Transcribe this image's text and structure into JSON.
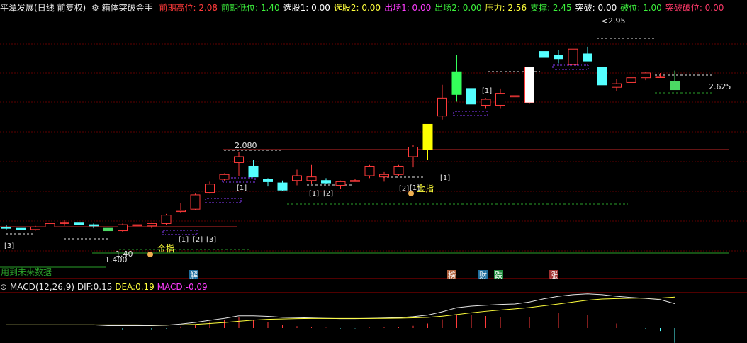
{
  "header": {
    "stock_name": "平潭发展",
    "period": "(日线 前复权)",
    "indicator": "箱体突破金手",
    "items": [
      {
        "label": "前期高位:",
        "value": "2.08",
        "color": "#ff3a3a"
      },
      {
        "label": "前期低位:",
        "value": "1.40",
        "color": "#3cf03c"
      },
      {
        "label": "选股1:",
        "value": "0.00",
        "color": "#ffffff"
      },
      {
        "label": "选股2:",
        "value": "0.00",
        "color": "#ffff3c"
      },
      {
        "label": "出场1:",
        "value": "0.00",
        "color": "#ff3cff"
      },
      {
        "label": "出场2:",
        "value": "0.00",
        "color": "#3cf03c"
      },
      {
        "label": "压力:",
        "value": "2.56",
        "color": "#ffff3c"
      },
      {
        "label": "支撑:",
        "value": "2.45",
        "color": "#3cf03c"
      },
      {
        "label": "突破:",
        "value": "0.00",
        "color": "#ffffff"
      },
      {
        "label": "破位:",
        "value": "1.00",
        "color": "#3cf03c"
      },
      {
        "label": "突破破位:",
        "value": "0.00",
        "color": "#ff3a6a"
      }
    ]
  },
  "annotations": {
    "high_price": "2.95",
    "high_marker": "<",
    "box_high": "2.080",
    "box_low": "1.400",
    "low_tag": "1.40",
    "last_price": "2.625",
    "gold_cross_1": "金指",
    "gold_cross_2": "金指",
    "tags": [
      "[3]",
      "[1]",
      "[2]",
      "[3]",
      "[1]",
      "[1]",
      "[2]",
      "[1]",
      "[2]",
      "[1]",
      "[1]"
    ],
    "future_note": "用到未来数据"
  },
  "events": [
    {
      "label": "解",
      "bg": "#1e6e9e",
      "fg": "#ffffff"
    },
    {
      "label": "榜",
      "bg": "#b0603c",
      "fg": "#ffffff"
    },
    {
      "label": "财",
      "bg": "#1e6e9e",
      "fg": "#ffffff"
    },
    {
      "label": "跌",
      "bg": "#1e8c3c",
      "fg": "#ffffff"
    },
    {
      "label": "涨",
      "bg": "#a03030",
      "fg": "#ffffff"
    }
  ],
  "macd": {
    "title": "MACD(12,26,9)",
    "dif_label": "DIF:",
    "dif_value": "0.15",
    "dea_label": "DEA:",
    "dea_value": "0.19",
    "macd_label": "MACD:",
    "macd_value": "-0.09"
  },
  "colors": {
    "up": "#ff3a3a",
    "down": "#54ffff",
    "grid": "#7a0000",
    "dif": "#e6e6e6",
    "dea": "#ffff3c",
    "support": "#3cf03c"
  },
  "chart_data": {
    "type": "candlestick",
    "ohlc": [
      [
        1.45,
        1.47,
        1.43,
        1.44
      ],
      [
        1.44,
        1.45,
        1.42,
        1.43
      ],
      [
        1.43,
        1.46,
        1.42,
        1.45
      ],
      [
        1.45,
        1.49,
        1.44,
        1.48
      ],
      [
        1.48,
        1.51,
        1.46,
        1.49
      ],
      [
        1.49,
        1.5,
        1.46,
        1.47
      ],
      [
        1.47,
        1.48,
        1.44,
        1.46
      ],
      [
        1.44,
        1.45,
        1.4,
        1.42
      ],
      [
        1.42,
        1.48,
        1.41,
        1.47
      ],
      [
        1.47,
        1.49,
        1.45,
        1.47
      ],
      [
        1.46,
        1.49,
        1.44,
        1.48
      ],
      [
        1.48,
        1.56,
        1.47,
        1.55
      ],
      [
        1.58,
        1.65,
        1.57,
        1.59
      ],
      [
        1.6,
        1.73,
        1.59,
        1.72
      ],
      [
        1.74,
        1.83,
        1.73,
        1.81
      ],
      [
        1.85,
        1.9,
        1.84,
        1.89
      ],
      [
        1.99,
        2.08,
        1.88,
        2.04
      ],
      [
        1.96,
        2.01,
        1.87,
        1.87
      ],
      [
        1.85,
        1.86,
        1.79,
        1.83
      ],
      [
        1.82,
        1.84,
        1.75,
        1.76
      ],
      [
        1.84,
        1.93,
        1.8,
        1.88
      ],
      [
        1.84,
        1.97,
        1.81,
        1.87
      ],
      [
        1.84,
        1.86,
        1.81,
        1.82
      ],
      [
        1.8,
        1.84,
        1.77,
        1.83
      ],
      [
        1.84,
        1.85,
        1.83,
        1.84
      ],
      [
        1.88,
        1.97,
        1.86,
        1.96
      ],
      [
        1.87,
        1.91,
        1.83,
        1.89
      ],
      [
        1.89,
        1.97,
        1.88,
        1.96
      ],
      [
        2.04,
        2.14,
        1.95,
        2.12
      ],
      [
        2.1,
        2.3,
        2.01,
        2.31
      ],
      [
        2.38,
        2.64,
        2.35,
        2.53
      ],
      [
        2.56,
        2.89,
        2.5,
        2.75
      ],
      [
        2.61,
        2.61,
        2.48,
        2.48
      ],
      [
        2.47,
        2.53,
        2.44,
        2.52
      ],
      [
        2.47,
        2.61,
        2.44,
        2.57
      ],
      [
        2.54,
        2.62,
        2.43,
        2.55
      ],
      [
        2.49,
        2.79,
        2.48,
        2.79
      ],
      [
        2.92,
        2.99,
        2.8,
        2.87
      ],
      [
        2.89,
        2.93,
        2.82,
        2.86
      ],
      [
        2.81,
        2.97,
        2.8,
        2.94
      ],
      [
        2.9,
        2.96,
        2.84,
        2.84
      ],
      [
        2.79,
        2.82,
        2.63,
        2.64
      ],
      [
        2.62,
        2.69,
        2.59,
        2.65
      ],
      [
        2.66,
        2.71,
        2.56,
        2.7
      ],
      [
        2.7,
        2.75,
        2.68,
        2.74
      ],
      [
        2.71,
        2.74,
        2.7,
        2.71
      ],
      [
        2.67,
        2.76,
        2.61,
        2.6
      ]
    ],
    "dif": [
      0.02,
      0.02,
      0.02,
      0.02,
      0.02,
      0.02,
      0.02,
      0.015,
      0.015,
      0.015,
      0.015,
      0.018,
      0.025,
      0.035,
      0.048,
      0.06,
      0.075,
      0.075,
      0.072,
      0.066,
      0.064,
      0.062,
      0.06,
      0.058,
      0.058,
      0.06,
      0.062,
      0.064,
      0.07,
      0.08,
      0.1,
      0.125,
      0.135,
      0.14,
      0.145,
      0.148,
      0.16,
      0.18,
      0.195,
      0.205,
      0.21,
      0.205,
      0.195,
      0.188,
      0.182,
      0.175,
      0.15
    ],
    "dea": [
      0.02,
      0.02,
      0.02,
      0.02,
      0.02,
      0.02,
      0.02,
      0.02,
      0.02,
      0.02,
      0.019,
      0.019,
      0.02,
      0.023,
      0.028,
      0.034,
      0.042,
      0.049,
      0.054,
      0.056,
      0.058,
      0.059,
      0.059,
      0.059,
      0.059,
      0.059,
      0.06,
      0.061,
      0.063,
      0.066,
      0.073,
      0.083,
      0.094,
      0.103,
      0.111,
      0.118,
      0.126,
      0.137,
      0.148,
      0.16,
      0.171,
      0.178,
      0.181,
      0.183,
      0.184,
      0.184,
      0.19
    ],
    "macd": [
      0,
      0,
      0,
      0,
      0,
      0,
      0,
      -0.01,
      -0.01,
      -0.01,
      -0.008,
      -0.002,
      0.01,
      0.024,
      0.04,
      0.052,
      0.066,
      0.052,
      0.036,
      0.02,
      0.012,
      0.006,
      0.002,
      -0.002,
      -0.002,
      0.002,
      0.004,
      0.006,
      0.014,
      0.028,
      0.054,
      0.084,
      0.082,
      0.074,
      0.068,
      0.06,
      0.068,
      0.086,
      0.094,
      0.09,
      0.078,
      0.054,
      0.028,
      0.01,
      -0.004,
      -0.018,
      -0.09
    ]
  }
}
